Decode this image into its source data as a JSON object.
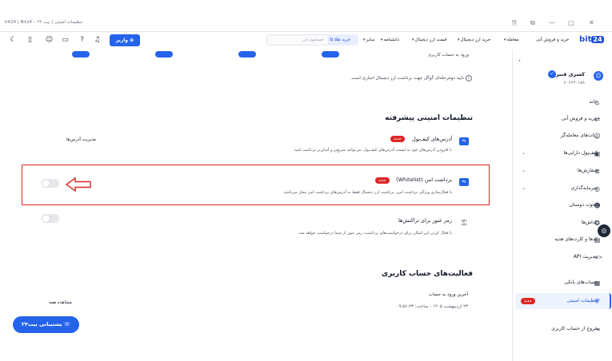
{
  "browser": {
    "tab_title": "bit24 | Bit24 – تنظیمات امنیتی | بیت ۲۴",
    "controls": [
      "⎘",
      "⧉",
      "—",
      "▢",
      "✕"
    ]
  },
  "header": {
    "logo_text": "bit",
    "logo_badge": "24",
    "nav": [
      {
        "label": "خرید و فروش آنی",
        "chevron": false
      },
      {
        "label": "معامله",
        "chevron": true
      },
      {
        "label": "خرید ارز دیجیتال",
        "chevron": true
      },
      {
        "label": "قیمت ارز دیجیتال",
        "chevron": true
      },
      {
        "label": "دانشنامه",
        "chevron": true
      },
      {
        "label": "سایر",
        "chevron": true
      }
    ],
    "search_placeholder": "جستجوی ارز",
    "gold_button": "خرید طلا",
    "deposit_button": "واریز"
  },
  "sidebar": {
    "user_name": "کسری قنبری",
    "user_id": "۷۰۶۲۳۰۱۵۸",
    "items": [
      {
        "label": "خانه",
        "icon": "⌂",
        "chevron": false
      },
      {
        "label": "خرید و فروش آنی",
        "icon": "⇄",
        "chevron": false
      },
      {
        "label": "ربات‌های معامله‌گر",
        "icon": "☺",
        "chevron": false
      },
      {
        "label": "کیف‌پول دارایی‌ها",
        "icon": "▣",
        "chevron": true
      },
      {
        "label": "سفارش‌ها",
        "icon": "≣",
        "chevron": true
      },
      {
        "label": "سرمایه‌گذاری",
        "icon": "◎",
        "chevron": true
      },
      {
        "label": "دعوت دوستان",
        "icon": "☻",
        "chevron": false
      },
      {
        "label": "پاداش‌ها",
        "icon": "✪",
        "chevron": false
      },
      {
        "label": "کدها و کارت‌های هدیه",
        "icon": "▤",
        "chevron": false
      },
      {
        "label": "مدیریت API",
        "icon": "</>",
        "chevron": false
      },
      {
        "label": "حساب‌های بانکی",
        "icon": "▦",
        "chevron": false
      },
      {
        "label": "تنظیمات امنیتی",
        "icon": "⛨",
        "chevron": false,
        "badge": "جدید"
      },
      {
        "label": "خروج از حساب کاربری",
        "icon": "⇥",
        "chevron": false
      }
    ]
  },
  "main": {
    "top_partial_text": "ورود به حساب کاربری",
    "note_text": "تایید دومرحله‌ای گوگل جهت برداشت ارز دیجیتال اجباری است.",
    "advanced_heading": "تنظیمات امنیتی پیشرفته",
    "features": [
      {
        "title": "آدرس‌های کیف‌پول",
        "badge": "جدید",
        "desc": "با افزودن آدرس‌های خود به لیست آدرس‌های کیف‌پول، می‌توانید سریع‌تر و آسان‌تر برداشت کنید.",
        "link": "مدیریت آدرس‌ها"
      },
      {
        "title": "برداشت امن (Whitelist)",
        "badge": "جدید",
        "desc": "با فعال‌سازی ویژگی برداشت امن، برداشت ارز دیجیتال فقط به آدرس‌های برداشت امن مجاز می‌باشد."
      },
      {
        "title": "رمز عبور برای تراکنش‌ها",
        "desc": "با فعال کردن این امکان برای درخواست‌های برداشت، رمز عبور از شما درخواست خواهد شد."
      }
    ],
    "activity_heading": "فعالیت‌های حساب کاربری",
    "last_login_label": "آخرین ورود به حساب",
    "last_login_value": "۲۳ اردیبهشت ۱۴۰۵ - ساعت: ۰۹:۵۶:۲۳",
    "view_all": "مشاهده همه",
    "support_button": "پشتیبانی بیت۲۴"
  },
  "colors": {
    "brand": "#2563eb",
    "danger": "#dc2626",
    "toggle_off": "#e5e7eb"
  }
}
